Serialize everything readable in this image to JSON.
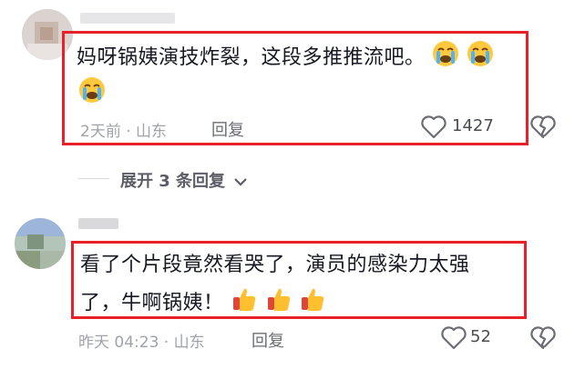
{
  "comments": [
    {
      "text": "妈呀锅姨演技炸裂，这段多推推流吧。",
      "meta": "2天前 · 山东",
      "reply_label": "回复",
      "likes": "1427",
      "emojis": [
        "crying-face",
        "crying-face",
        "crying-face"
      ]
    },
    {
      "text_line1": "看了个片段竟然看哭了，演员的感染力太强",
      "text_line2": "了，牛啊锅姨！",
      "meta": "昨天 04:23 · 山东",
      "reply_label": "回复",
      "likes": "52",
      "emojis": [
        "thumbs-up",
        "thumbs-up",
        "thumbs-up"
      ]
    }
  ],
  "expand_replies": "展开 3 条回复",
  "colors": {
    "highlight": "#e8202a",
    "meta": "#a0a3ab",
    "text": "#161823"
  }
}
